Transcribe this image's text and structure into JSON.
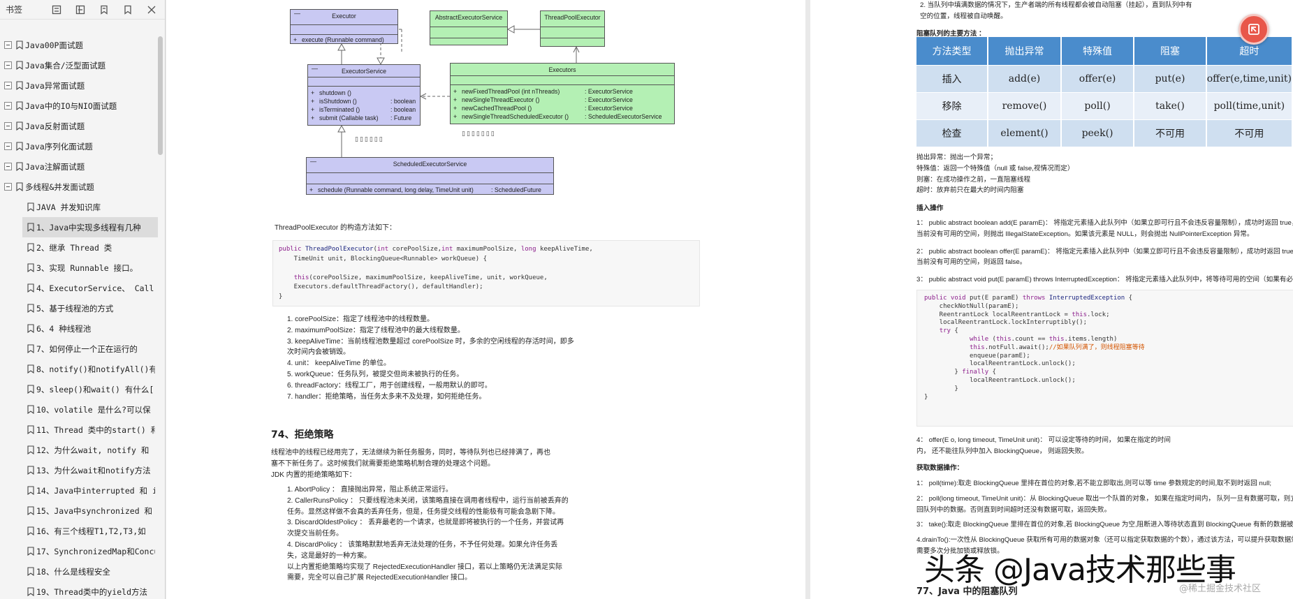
{
  "sidebar": {
    "title": "书签",
    "tools": [
      "expand-all-icon",
      "collapse-all-icon",
      "add-bookmark-icon",
      "bookmark-icon",
      "close-icon"
    ],
    "top_items": [
      "Java00P面试题",
      "Java集合/泛型面试题",
      "Java异常面试题",
      "Java中的IO与NIO面试题",
      "Java反射面试题",
      "Java序列化面试题",
      "Java注解面试题",
      "多线程&并发面试题"
    ],
    "child_items": [
      "JAVA 并发知识库",
      "1、Java中实现多线程有几种",
      "2、继承 Thread 类",
      "3、实现 Runnable 接口。",
      "4、ExecutorService、 Call",
      "5、基于线程池的方式",
      "6、4 种线程池",
      "7、如何停止一个正在运行的",
      "8、notify()和notifyAll()有",
      "9、sleep()和wait() 有什么[",
      "10、volatile 是什么?可以保",
      "11、Thread 类中的start() 和",
      "12、为什么wait, notify 和",
      "13、为什么wait和notify方法",
      "14、Java中interrupted 和 i",
      "15、Java中synchronized 和",
      "16、有三个线程T1,T2,T3,如",
      "17、SynchronizedMap和Concu",
      "18、什么是线程安全",
      "19、Thread类中的yield方法"
    ]
  },
  "uml": {
    "executor": {
      "name": "Executor",
      "method": "execute (Runnable command)"
    },
    "abstract_executor_service": {
      "name": "AbstractExecutorService"
    },
    "thread_pool_executor": {
      "name": "ThreadPoolExecutor"
    },
    "executor_service": {
      "name": "ExecutorService",
      "methods": [
        {
          "sig": "shutdown ()",
          "ret": ""
        },
        {
          "sig": "isShutdown ()",
          "ret": ": boolean"
        },
        {
          "sig": "isTerminated ()",
          "ret": ": boolean"
        },
        {
          "sig": "submit (Callable task)",
          "ret": ": Future"
        }
      ]
    },
    "executors": {
      "name": "Executors",
      "methods": [
        {
          "sig": "newFixedThreadPool (int nThreads)",
          "ret": ": ExecutorService"
        },
        {
          "sig": "newSingleThreadExecutor ()",
          "ret": ": ExecutorService"
        },
        {
          "sig": "newCachedThreadPool ()",
          "ret": ": ExecutorService"
        },
        {
          "sig": "newSingleThreadScheduledExecutor ()",
          "ret": ": ScheduledExecutorService"
        }
      ]
    },
    "scheduled_executor_service": {
      "name": "ScheduledExecutorService",
      "method": "schedule (Runnable command, long delay, TimeUnit unit)",
      "ret": ": ScheduledFuture"
    },
    "garbled_label_1": "▯▯▯▯▯▯",
    "garbled_label_2": "▯▯▯▯▯▯▯"
  },
  "left_page": {
    "constructor_intro": "ThreadPoolExecutor 的构造方法如下：",
    "params": [
      "1. corePoolSize：指定了线程池中的线程数量。",
      "2. maximumPoolSize：指定了线程池中的最大线程数量。",
      "3. keepAliveTime：当前线程池数量超过 corePoolSize 时，多余的空闲线程的存活时间，即多",
      "    次时间内会被销毁。",
      "4. unit： keepAliveTime 的单位。",
      "5. workQueue：任务队列，被提交但尚未被执行的任务。",
      "6. threadFactory：线程工厂，用于创建线程，一般用默认的即可。",
      "7. handler：拒绝策略，当任务太多来不及处理，如何拒绝任务。"
    ],
    "section_title": "74、拒绝策略",
    "section_intro": [
      "线程池中的线程已经用完了，无法继续为新任务服务，同时，等待队列也已经排满了，再也",
      "塞不下新任务了。这时候我们就需要拒绝策略机制合理的处理这个问题。",
      "JDK 内置的拒绝策略如下："
    ],
    "policies": [
      "1. AbortPolicy ： 直接抛出异常，阻止系统正常运行。",
      "2. CallerRunsPolicy ： 只要线程池未关闭，该策略直接在调用者线程中，运行当前被丢弃的",
      "    任务。显然这样做不会真的丢弃任务，但是，任务提交线程的性能极有可能会急剧下降。",
      "3. DiscardOldestPolicy ： 丢弃最老的一个请求，也就是即将被执行的一个任务，并尝试再",
      "    次提交当前任务。",
      "4. DiscardPolicy ： 该策略默默地丢弃无法处理的任务，不予任何处理。如果允许任务丢",
      "    失，这是最好的一种方案。",
      "    以上内置拒绝策略均实现了 RejectedExecutionHandler 接口，若以上策略仍无法满足实际",
      "    需要，完全可以自己扩展 RejectedExecutionHandler 接口。"
    ]
  },
  "right_page": {
    "top_lines": [
      "2. 当队列中填满数据的情况下，生产者端的所有线程都会被自动阻塞（挂起），直到队列中有",
      "    空的位置，线程被自动唤醒。"
    ],
    "methods_title": "阻塞队列的主要方法 ：",
    "table": {
      "headers": [
        "方法类型",
        "抛出异常",
        "特殊值",
        "阻塞",
        "超时"
      ],
      "rows": [
        [
          "插入",
          "add(e)",
          "offer(e)",
          "put(e)",
          "offer(e,time,unit)"
        ],
        [
          "移除",
          "remove()",
          "poll()",
          "take()",
          "poll(time,unit)"
        ],
        [
          "检查",
          "element()",
          "peek()",
          "不可用",
          "不可用"
        ]
      ]
    },
    "legend": [
      "抛出异常：抛出一个异常；",
      "特殊值：返回一个特殊值（null 或 false,视情况而定）",
      "则塞：在成功操作之前，一直阻塞线程",
      "超时：放弃前只在最大的时间内阻塞"
    ],
    "insert_title": "插入操作",
    "insert_lines": [
      "1： public abstract boolean add(E paramE)： 将指定元素插入此队列中（如果立即可行且不会违反容量限制），成功时返回 true，如果",
      "当前没有可用的空间，则抛出 IllegalStateException。如果该元素是 NULL，则会抛出 NullPointerException 异常。",
      "2： public abstract boolean offer(E paramE)： 将指定元素插入此队列中（如果立即可行且不会违反容量限制），成功时返回 true，如果",
      "当前没有可用的空间，则返回 false。",
      "3： public abstract void put(E paramE) throws InterruptedException： 将指定元素插入此队列中，将等待可用的空间（如果有必要）"
    ],
    "offer_lines": [
      "4： offer(E o, long timeout, TimeUnit unit)： 可以设定等待的时间， 如果在指定的时间",
      "内， 还不能往队列中加入 BlockingQueue， 则返回失败。"
    ],
    "fetch_title": "获取数据操作：",
    "fetch_lines": [
      "1： poll(time):取走 BlockingQueue 里排在首位的对象,若不能立即取出,则可以等 time 参数规定的时间,取不到时返回 null;",
      "2： poll(long timeout, TimeUnit unit)：从 BlockingQueue 取出一个队首的对象， 如果在指定时间内， 队列一旦有数据可取，则立即返",
      "回队列中的数据。否则直到时间超时还没有数据可取，返回失败。",
      "3： take():取走 BlockingQueue 里排在首位的对象,若 BlockingQueue 为空,阻断进入等待状态直到 BlockingQueue 有新的数据被加入。",
      "4.drainTo():一次性从 BlockingQueue 获取所有可用的数据对象（还可以指定获取数据的个数），通过该方法，可以提升获取数据效率；不",
      "需要多次分批加锁或释放锁。"
    ],
    "section_77": "77、Java 中的阻塞队列"
  },
  "watermark": {
    "main": "头条 @Java技术那些事",
    "sub": "@稀土掘金技术社区"
  },
  "fab": {
    "icon": "share-icon"
  }
}
